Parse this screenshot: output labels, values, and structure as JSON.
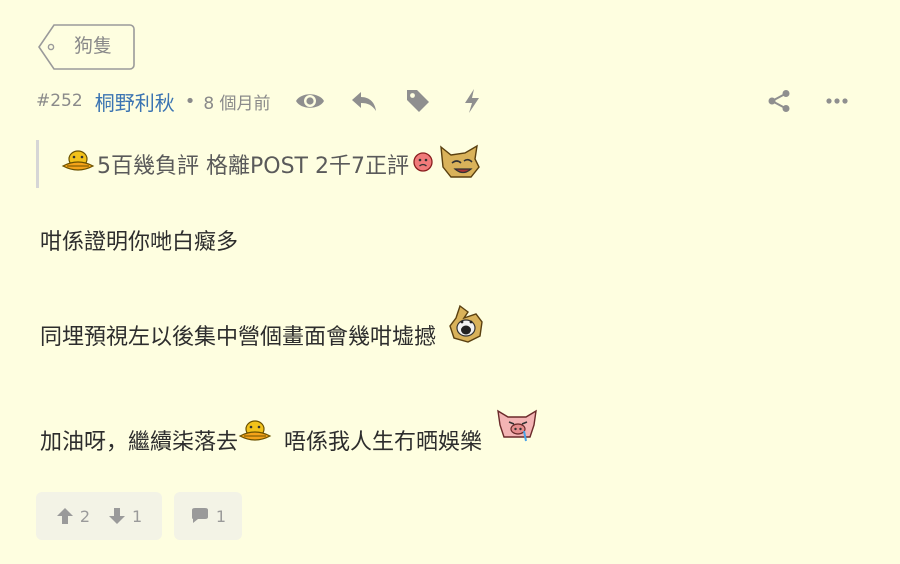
{
  "tag": {
    "label": "狗隻"
  },
  "post": {
    "number": "#252",
    "user": "桐野利秋",
    "separator": "•",
    "time": "8 個月前",
    "header_icons": [
      "eye-icon",
      "reply-icon",
      "tag-icon",
      "lightning-icon"
    ],
    "right_icons": [
      "share-icon",
      "more-icon"
    ]
  },
  "quote": {
    "text": "5百幾負評 格離POST 2千7正評"
  },
  "body": {
    "line1": "咁係證明你哋白癡多",
    "line2": "同埋預視左以後集中營個畫面會幾咁墟撼",
    "line3a": "加油呀，繼續柒落去",
    "line3b": "唔係我人生冇晒娛樂"
  },
  "footer": {
    "upvotes": "2",
    "downvotes": "1",
    "replies": "1"
  },
  "colors": {
    "background": "#fefee0",
    "username": "#3b74b2",
    "muted": "#8a8a8a",
    "button_bg": "#f3f3e6"
  }
}
